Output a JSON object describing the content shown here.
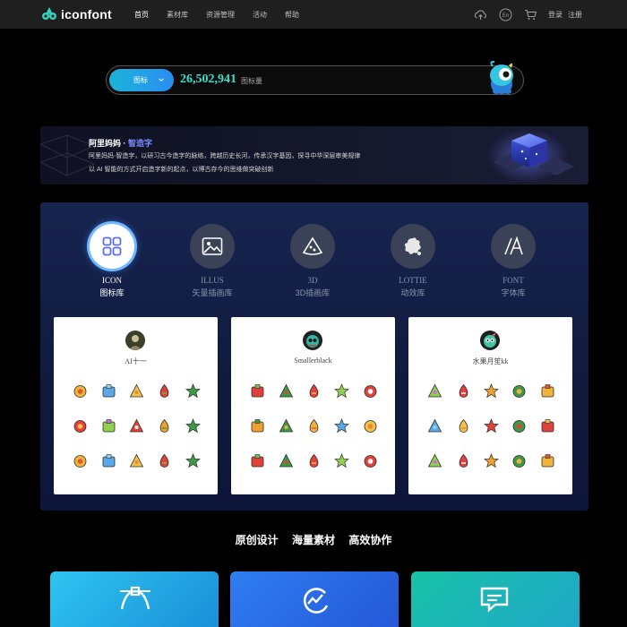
{
  "nav": {
    "brand": "iconfont",
    "links": [
      "首页",
      "素材库",
      "资源管理",
      "活动",
      "帮助"
    ],
    "lang": "En",
    "login": "登录",
    "register": "注册"
  },
  "search": {
    "type_label": "图标",
    "count": "26,502,941",
    "unit": "图标量"
  },
  "banner": {
    "title_a": "阿里妈妈 · ",
    "title_b": "智造字",
    "line1": "阿里妈妈·智造字，以研习古今造字的脉络，跨越历史长河，传承汉字基因，探寻中华深层审美规律",
    "line2": "以 AI 智能的方式开启造字新的起点，以博古存今的思维做突破创新"
  },
  "categories": [
    {
      "en": "ICON",
      "cn": "图标库",
      "icon": "grid-icon"
    },
    {
      "en": "ILLUS",
      "cn": "矢量插画库",
      "icon": "image-icon"
    },
    {
      "en": "3D",
      "cn": "3D插画库",
      "icon": "pizza-icon"
    },
    {
      "en": "LOTTIE",
      "cn": "动效库",
      "icon": "splash-icon"
    },
    {
      "en": "FONT",
      "cn": "字体库",
      "icon": "font-a-icon"
    }
  ],
  "cards": [
    {
      "name": "AI十一",
      "icons": [
        "star",
        "snow-cloud",
        "magic-wand",
        "stocking",
        "holly",
        "candy-pouch",
        "lights",
        "candy-cane",
        "candles",
        "tree",
        "bauble",
        "santa-bag",
        "snowflake",
        "calendar",
        "mug"
      ]
    },
    {
      "name": "Smallerblack",
      "icons": [
        "gift",
        "candy-cane",
        "wreath-bell",
        "pudding",
        "gift-box",
        "santa-hat-face",
        "ornament",
        "present",
        "santa-hat",
        "reindeer",
        "wreath",
        "house",
        "mistletoe",
        "cane",
        "gingerbread"
      ]
    },
    {
      "name": "水果月笙kk",
      "icons": [
        "cake-slice",
        "lollipop",
        "bun",
        "popcorn",
        "ice-cream",
        "cookie",
        "pudding-flan",
        "cake",
        "pie",
        "fish-cake",
        "muffin",
        "ice-cream-cone",
        "rice-ball",
        "tart",
        "burger"
      ]
    }
  ],
  "tagline": [
    "原创设计",
    "海量素材",
    "高效协作"
  ],
  "colors": {
    "accent": "#2a8ef3",
    "count": "#3ce0c8",
    "panel": "#17244f"
  }
}
